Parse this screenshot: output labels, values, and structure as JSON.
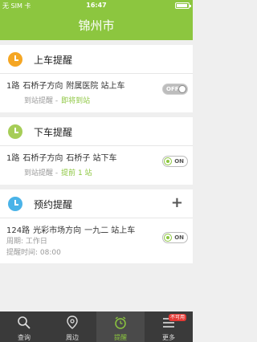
{
  "status_bar": {
    "carrier": "无 SIM 卡",
    "time": "16:47"
  },
  "nav": {
    "title": "锦州市"
  },
  "colors": {
    "accent": "#8cc63f",
    "section1_icon": "#f5a623",
    "section2_icon": "#a6cd57",
    "section3_icon": "#4ab3e8"
  },
  "sections": [
    {
      "title": "上车提醒",
      "icon": "clock-icon",
      "row": {
        "route": "1路",
        "direction": "石桥子方向",
        "station": "附属医院 站上车",
        "sub_label": "到站提醒 -",
        "sub_value": "即将到站",
        "toggle": "OFF"
      }
    },
    {
      "title": "下车提醒",
      "icon": "clock-icon",
      "row": {
        "route": "1路",
        "direction": "石桥子方向",
        "station": "石桥子 站下车",
        "sub_label": "到站提醒 -",
        "sub_value": "提前 1 站",
        "toggle": "ON"
      }
    },
    {
      "title": "预约提醒",
      "icon": "clock-icon",
      "row": {
        "route": "124路",
        "direction": "光彩市场方向",
        "station": "一九二 站上车",
        "period": "周期: 工作日",
        "time": "提醒时间: 08:00",
        "toggle": "ON"
      }
    }
  ],
  "tabs": [
    {
      "label": "查询",
      "icon": "search-icon"
    },
    {
      "label": "周边",
      "icon": "map-pin-icon"
    },
    {
      "label": "提醒",
      "icon": "alarm-icon",
      "active": true
    },
    {
      "label": "更多",
      "icon": "menu-icon",
      "badge": "不可用"
    }
  ]
}
